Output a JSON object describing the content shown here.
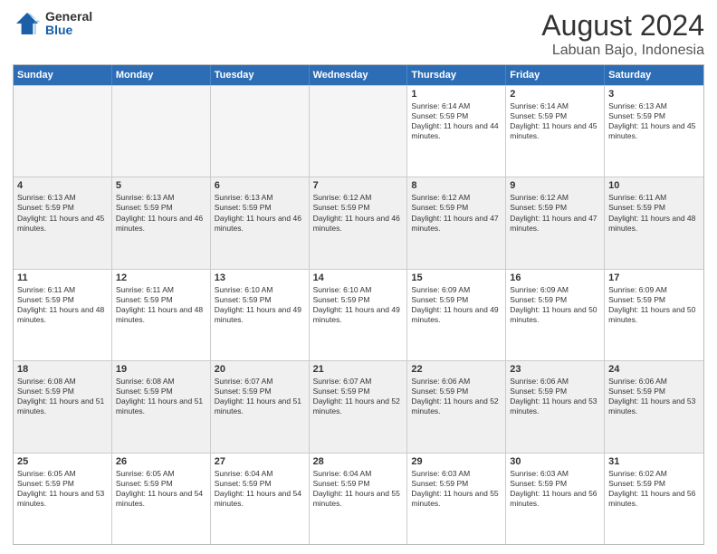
{
  "logo": {
    "general": "General",
    "blue": "Blue"
  },
  "title": "August 2024",
  "subtitle": "Labuan Bajo, Indonesia",
  "days_of_week": [
    "Sunday",
    "Monday",
    "Tuesday",
    "Wednesday",
    "Thursday",
    "Friday",
    "Saturday"
  ],
  "weeks": [
    [
      {
        "day": "",
        "empty": true
      },
      {
        "day": "",
        "empty": true
      },
      {
        "day": "",
        "empty": true
      },
      {
        "day": "",
        "empty": true
      },
      {
        "day": "1",
        "sunrise": "6:14 AM",
        "sunset": "5:59 PM",
        "daylight": "11 hours and 44 minutes."
      },
      {
        "day": "2",
        "sunrise": "6:14 AM",
        "sunset": "5:59 PM",
        "daylight": "11 hours and 45 minutes."
      },
      {
        "day": "3",
        "sunrise": "6:13 AM",
        "sunset": "5:59 PM",
        "daylight": "11 hours and 45 minutes."
      }
    ],
    [
      {
        "day": "4",
        "sunrise": "6:13 AM",
        "sunset": "5:59 PM",
        "daylight": "11 hours and 45 minutes."
      },
      {
        "day": "5",
        "sunrise": "6:13 AM",
        "sunset": "5:59 PM",
        "daylight": "11 hours and 46 minutes."
      },
      {
        "day": "6",
        "sunrise": "6:13 AM",
        "sunset": "5:59 PM",
        "daylight": "11 hours and 46 minutes."
      },
      {
        "day": "7",
        "sunrise": "6:12 AM",
        "sunset": "5:59 PM",
        "daylight": "11 hours and 46 minutes."
      },
      {
        "day": "8",
        "sunrise": "6:12 AM",
        "sunset": "5:59 PM",
        "daylight": "11 hours and 47 minutes."
      },
      {
        "day": "9",
        "sunrise": "6:12 AM",
        "sunset": "5:59 PM",
        "daylight": "11 hours and 47 minutes."
      },
      {
        "day": "10",
        "sunrise": "6:11 AM",
        "sunset": "5:59 PM",
        "daylight": "11 hours and 48 minutes."
      }
    ],
    [
      {
        "day": "11",
        "sunrise": "6:11 AM",
        "sunset": "5:59 PM",
        "daylight": "11 hours and 48 minutes."
      },
      {
        "day": "12",
        "sunrise": "6:11 AM",
        "sunset": "5:59 PM",
        "daylight": "11 hours and 48 minutes."
      },
      {
        "day": "13",
        "sunrise": "6:10 AM",
        "sunset": "5:59 PM",
        "daylight": "11 hours and 49 minutes."
      },
      {
        "day": "14",
        "sunrise": "6:10 AM",
        "sunset": "5:59 PM",
        "daylight": "11 hours and 49 minutes."
      },
      {
        "day": "15",
        "sunrise": "6:09 AM",
        "sunset": "5:59 PM",
        "daylight": "11 hours and 49 minutes."
      },
      {
        "day": "16",
        "sunrise": "6:09 AM",
        "sunset": "5:59 PM",
        "daylight": "11 hours and 50 minutes."
      },
      {
        "day": "17",
        "sunrise": "6:09 AM",
        "sunset": "5:59 PM",
        "daylight": "11 hours and 50 minutes."
      }
    ],
    [
      {
        "day": "18",
        "sunrise": "6:08 AM",
        "sunset": "5:59 PM",
        "daylight": "11 hours and 51 minutes."
      },
      {
        "day": "19",
        "sunrise": "6:08 AM",
        "sunset": "5:59 PM",
        "daylight": "11 hours and 51 minutes."
      },
      {
        "day": "20",
        "sunrise": "6:07 AM",
        "sunset": "5:59 PM",
        "daylight": "11 hours and 51 minutes."
      },
      {
        "day": "21",
        "sunrise": "6:07 AM",
        "sunset": "5:59 PM",
        "daylight": "11 hours and 52 minutes."
      },
      {
        "day": "22",
        "sunrise": "6:06 AM",
        "sunset": "5:59 PM",
        "daylight": "11 hours and 52 minutes."
      },
      {
        "day": "23",
        "sunrise": "6:06 AM",
        "sunset": "5:59 PM",
        "daylight": "11 hours and 53 minutes."
      },
      {
        "day": "24",
        "sunrise": "6:06 AM",
        "sunset": "5:59 PM",
        "daylight": "11 hours and 53 minutes."
      }
    ],
    [
      {
        "day": "25",
        "sunrise": "6:05 AM",
        "sunset": "5:59 PM",
        "daylight": "11 hours and 53 minutes."
      },
      {
        "day": "26",
        "sunrise": "6:05 AM",
        "sunset": "5:59 PM",
        "daylight": "11 hours and 54 minutes."
      },
      {
        "day": "27",
        "sunrise": "6:04 AM",
        "sunset": "5:59 PM",
        "daylight": "11 hours and 54 minutes."
      },
      {
        "day": "28",
        "sunrise": "6:04 AM",
        "sunset": "5:59 PM",
        "daylight": "11 hours and 55 minutes."
      },
      {
        "day": "29",
        "sunrise": "6:03 AM",
        "sunset": "5:59 PM",
        "daylight": "11 hours and 55 minutes."
      },
      {
        "day": "30",
        "sunrise": "6:03 AM",
        "sunset": "5:59 PM",
        "daylight": "11 hours and 56 minutes."
      },
      {
        "day": "31",
        "sunrise": "6:02 AM",
        "sunset": "5:59 PM",
        "daylight": "11 hours and 56 minutes."
      }
    ]
  ],
  "labels": {
    "sunrise": "Sunrise:",
    "sunset": "Sunset:",
    "daylight": "Daylight:"
  }
}
